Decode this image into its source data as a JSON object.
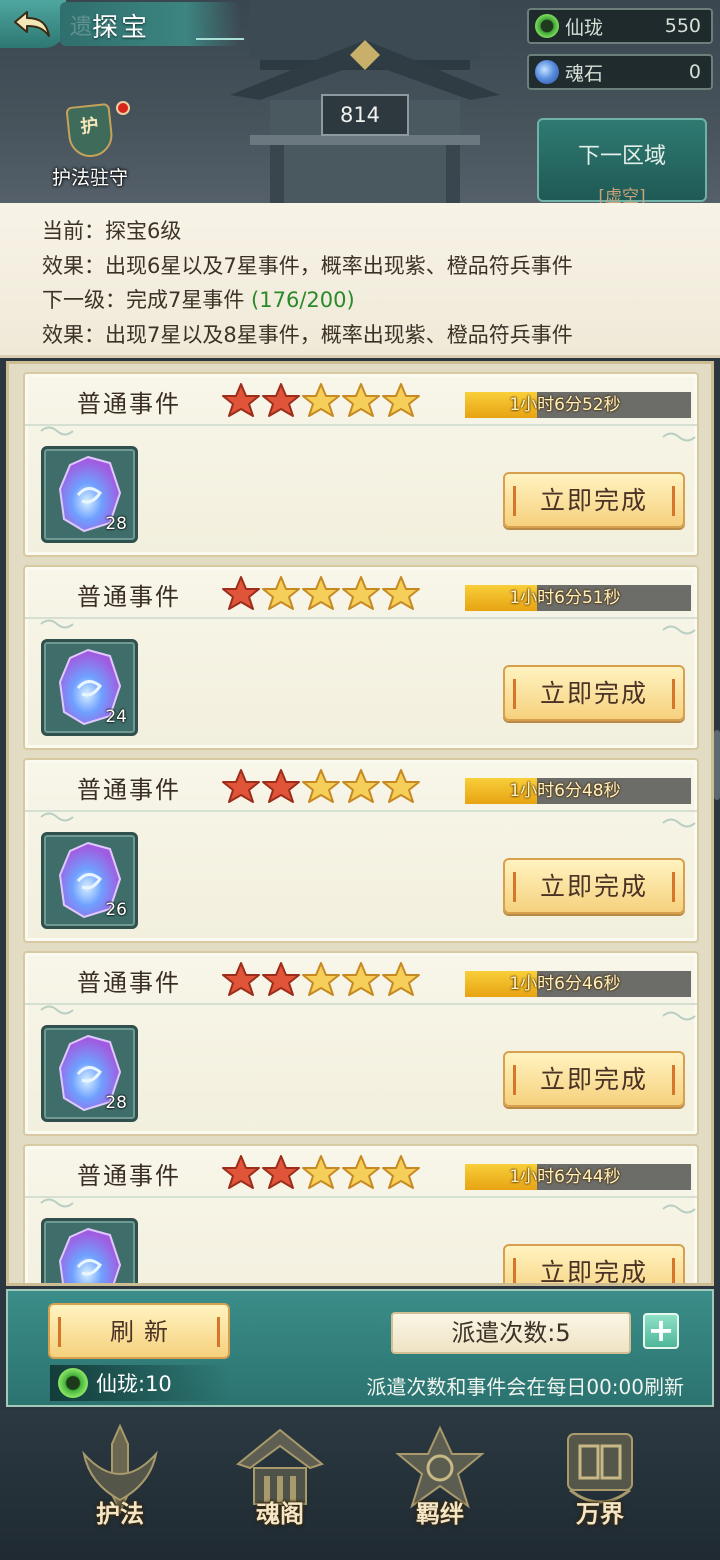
{
  "header": {
    "title": "探宝",
    "title_ghost": "遗迹",
    "tower_number": "814",
    "guard_label": "护法驻守",
    "guard_badge_char": "护",
    "next_region_label": "下一区域",
    "next_region_sub": "[虚空]"
  },
  "resources": [
    {
      "name": "仙珑",
      "value": "550",
      "icon": "jade-ring-icon",
      "color": "#3fa33a"
    },
    {
      "name": "魂石",
      "value": "0",
      "icon": "soul-stone-icon",
      "color": "#4a7fd6"
    }
  ],
  "info": {
    "current_label": "当前：",
    "current_value": "探宝6级",
    "effect_label": "效果：",
    "effect_value": "出现6星以及7星事件，概率出现紫、橙品符兵事件",
    "next_label": "下一级：",
    "next_value": "完成7星事件 ",
    "next_progress": "(176/200)",
    "next_effect_label": "效果：",
    "next_effect_value": "出现7星以及8星事件，概率出现紫、橙品符兵事件"
  },
  "events": [
    {
      "type": "普通事件",
      "stars_filled": 2,
      "stars_total": 5,
      "timer": "1小时6分52秒",
      "progress": 0.32,
      "item_qty": "28",
      "action": "立即完成"
    },
    {
      "type": "普通事件",
      "stars_filled": 1,
      "stars_total": 5,
      "timer": "1小时6分51秒",
      "progress": 0.32,
      "item_qty": "24",
      "action": "立即完成"
    },
    {
      "type": "普通事件",
      "stars_filled": 2,
      "stars_total": 5,
      "timer": "1小时6分48秒",
      "progress": 0.32,
      "item_qty": "26",
      "action": "立即完成"
    },
    {
      "type": "普通事件",
      "stars_filled": 2,
      "stars_total": 5,
      "timer": "1小时6分46秒",
      "progress": 0.32,
      "item_qty": "28",
      "action": "立即完成"
    },
    {
      "type": "普通事件",
      "stars_filled": 2,
      "stars_total": 5,
      "timer": "1小时6分44秒",
      "progress": 0.32,
      "item_qty": "",
      "action": "立即完成"
    }
  ],
  "controls": {
    "refresh_label": "刷新",
    "cost_label": "仙珑:10",
    "dispatch_label": "派遣次数:5",
    "plus_label": "+",
    "note": "派遣次数和事件会在每日00:00刷新"
  },
  "nav": [
    {
      "label": "护法",
      "icon": "sword-emblem-icon"
    },
    {
      "label": "魂阁",
      "icon": "pavilion-emblem-icon"
    },
    {
      "label": "羁绊",
      "icon": "bond-emblem-icon"
    },
    {
      "label": "万界",
      "icon": "realm-emblem-icon"
    }
  ],
  "colors": {
    "teal": "#2f7a72",
    "star_filled": "#e0553a",
    "star_empty": "#f6cf5a",
    "timer_fill": "#f0b424",
    "green_text": "#2a8a2a"
  }
}
